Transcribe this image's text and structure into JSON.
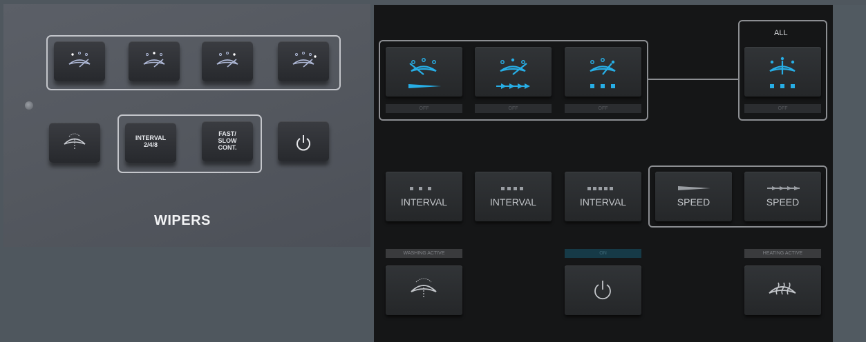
{
  "physical_panel": {
    "title": "WIPERS",
    "interval_button": "INTERVAL\n2/4/8",
    "fast_slow_button": "FAST/\nSLOW\nCONT.",
    "top_buttons": [
      "wiper-1-icon",
      "wiper-2-icon",
      "wiper-3-icon",
      "wiper-all-icon"
    ]
  },
  "digital_panel": {
    "all_label": "ALL",
    "wiper_status": [
      "OFF",
      "OFF",
      "OFF"
    ],
    "all_status": "OFF",
    "interval_buttons": [
      "INTERVAL",
      "INTERVAL",
      "INTERVAL"
    ],
    "speed_buttons": [
      "SPEED",
      "SPEED"
    ],
    "washing_label": "WASHING ACTIVE",
    "power_label": "ON",
    "heating_label": "HEATING ACTIVE"
  },
  "colors": {
    "active_blue": "#27aee6",
    "panel_dark": "#151617",
    "physical_bg": "#56595f"
  }
}
